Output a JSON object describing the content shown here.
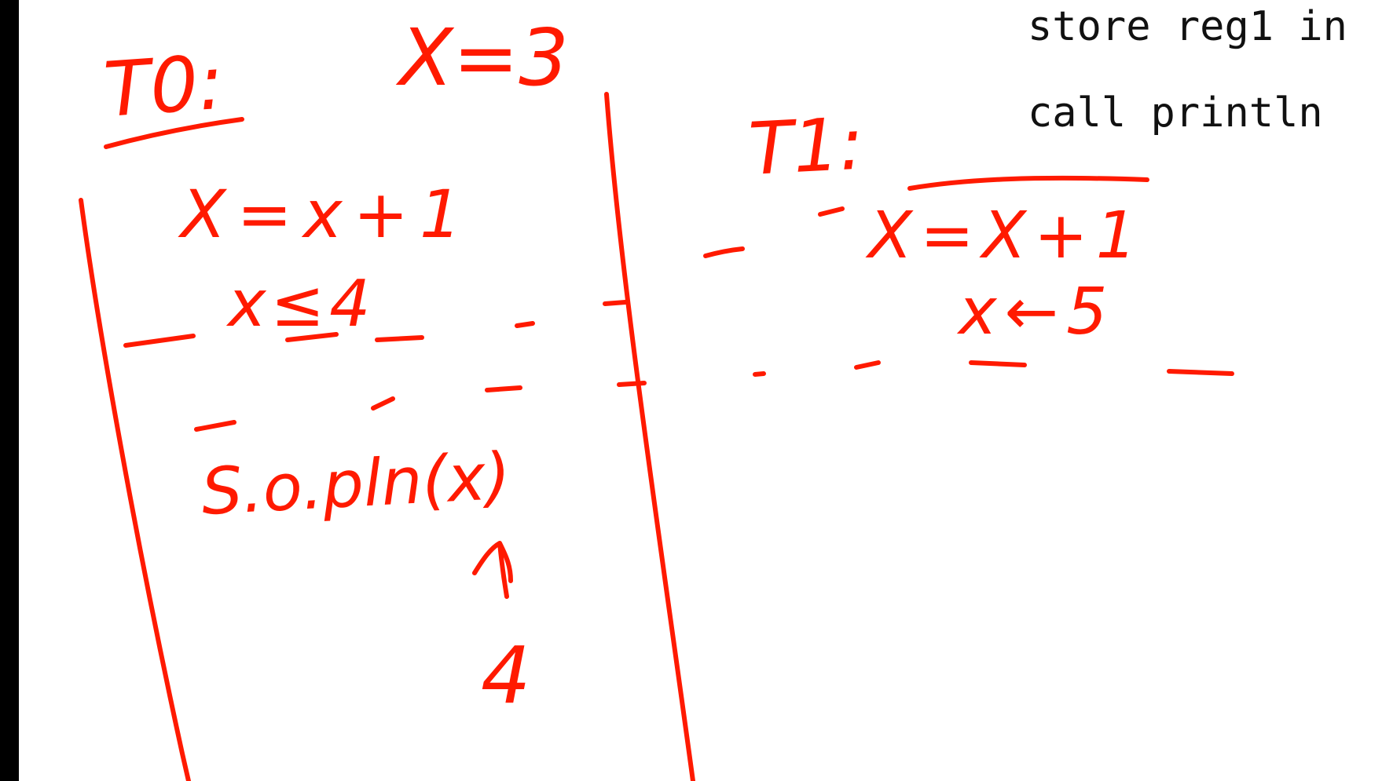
{
  "code": {
    "line1": "store reg1 in",
    "line2": "call println"
  },
  "annotations": {
    "t0_label": "T0:",
    "x_init": "X=3",
    "t0_stmt": "X=x+1",
    "t0_write": "x≤4",
    "t0_print": "S.o.pln(x)",
    "t0_result": "4",
    "t1_label": "T1:",
    "t1_stmt": "X=X+1",
    "t1_write": "x←5"
  },
  "colors": {
    "ink": "#ff1a00",
    "background": "#ffffff",
    "frame": "#000000",
    "code_text": "#111111"
  }
}
